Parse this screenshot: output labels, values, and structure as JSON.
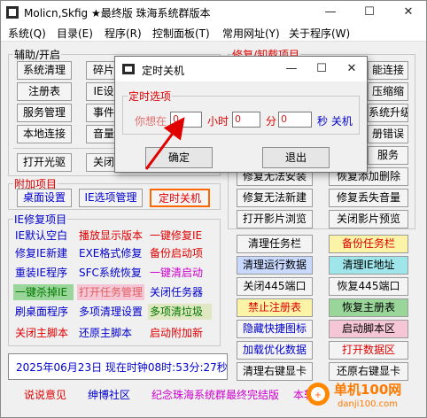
{
  "window": {
    "title": "Molicn,Skfig ★最终版 珠海系统群版本",
    "min": "—",
    "max": "☐",
    "close": "✕"
  },
  "menu": [
    "系统(Q)",
    "目录(E)",
    "程序(R)",
    "控制面板(T)",
    "常用网址(Y)",
    "关于程序(W)"
  ],
  "groups": {
    "assist": "辅助/开启",
    "repair": "修复/卸载项目",
    "extra": "附加项目",
    "ie": "IE修复项目"
  },
  "assist_buttons": [
    "系统清理",
    "碎片",
    "注册表",
    "IE设",
    "服务管理",
    "事件",
    "本地连接",
    "音量",
    "打开光驱",
    "关闭"
  ],
  "repair_right_partial": [
    "能连接",
    "压缩缩",
    "系统升级",
    "册错误",
    "服务"
  ],
  "repair_rows": [
    {
      "left": "修复无法安装",
      "right": "恢复添加删除"
    },
    {
      "left": "修复无法新建",
      "right": "修复丢失音量"
    },
    {
      "left": "打开影片浏览",
      "right": "关闭影片预览"
    }
  ],
  "extra_buttons": [
    "桌面设置",
    "IE选项管理",
    "定时关机"
  ],
  "ie_labels": [
    [
      "IE默认空白",
      "播放显示版本",
      "一键修复IE"
    ],
    [
      "修复IE新建",
      "EXE格式修复",
      "备份启动项"
    ],
    [
      "重装IE程序",
      "SFC系统恢复",
      "一键清启动"
    ],
    [
      "一键杀掉IE",
      "打开任务管理",
      "关闭任务器"
    ],
    [
      "刷桌面程序",
      "多项清理设置",
      "多项清垃圾"
    ],
    [
      "关闭主脚本",
      "还原主脚本",
      "启动附加新"
    ]
  ],
  "right_rows": [
    [
      "清理任务栏",
      "备份任务栏"
    ],
    [
      "清理运行数据",
      "清理IE地址"
    ],
    [
      "关闭445端口",
      "恢复445端口"
    ],
    [
      "禁止注册表",
      "恢复主册表"
    ],
    [
      "隐藏快捷图标",
      "启动脚本区"
    ],
    [
      "加载优化数据",
      "打开数据区"
    ],
    [
      "清理右键显卡",
      "还原右键显卡"
    ]
  ],
  "status": "2025年06月23日 现在时钟08时:53分:27秒",
  "footer": [
    "说说意见",
    "绅博社区",
    "纪念珠海系统群最终完结版",
    "本软"
  ],
  "watermark": {
    "site": "单机100网",
    "url": "danji100.com"
  },
  "dialog": {
    "title": "定时关机",
    "min": "—",
    "max": "☐",
    "close": "✕",
    "group": "定时选项",
    "prompt": "你想在",
    "hour_value": "0",
    "hour_unit": "小时",
    "min_value": "0",
    "min_unit": "分",
    "sec_value": "0",
    "sec_unit": "秒 关机",
    "ok": "确定",
    "exit": "退出"
  },
  "colors": {
    "red": "#e00000",
    "blue": "#0000cc",
    "green": "#007700",
    "magenta": "#cc00cc",
    "btn_blue_bg": "#c9d8ff",
    "btn_green_bg": "#9ad69a",
    "btn_pink_bg": "#f5c6d6",
    "btn_yellow_bg": "#fbf3a6",
    "btn_cyan_bg": "#9fe6ea"
  }
}
